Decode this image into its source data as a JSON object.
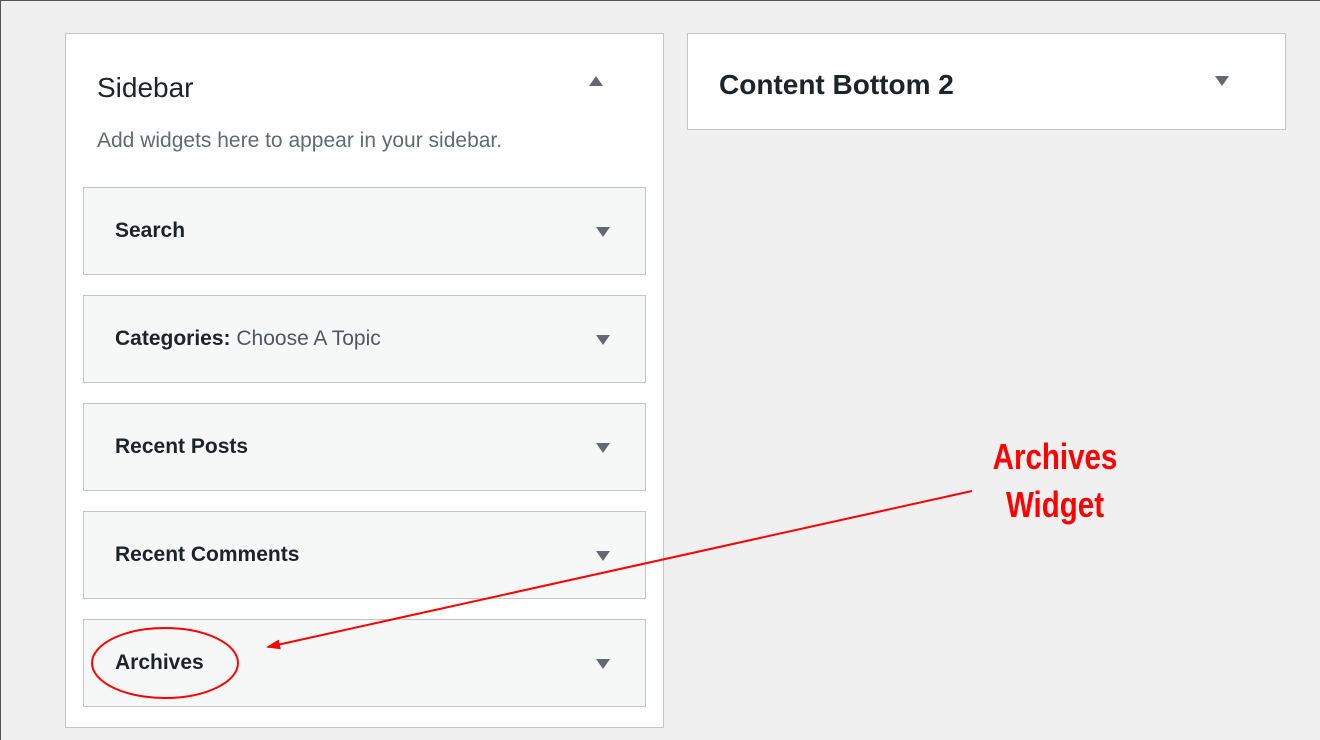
{
  "sidebar": {
    "title": "Sidebar",
    "description": "Add widgets here to appear in your sidebar.",
    "toggle_icon": "arrow-up-icon",
    "widgets": [
      {
        "title": "Search",
        "subtitle": ""
      },
      {
        "title": "Categories:",
        "subtitle": "Choose A Topic"
      },
      {
        "title": "Recent Posts",
        "subtitle": ""
      },
      {
        "title": "Recent Comments",
        "subtitle": ""
      },
      {
        "title": "Archives",
        "subtitle": ""
      }
    ]
  },
  "content_bottom": {
    "title": "Content Bottom 2",
    "toggle_icon": "arrow-down-icon"
  },
  "annotation": {
    "line1": "Archives",
    "line2": "Widget",
    "color": "#ff0000"
  },
  "colors": {
    "background": "#f0f0f1",
    "card": "#ffffff",
    "widget": "#f6f7f7",
    "border": "#c3c4c7",
    "arrow": "#646970"
  }
}
